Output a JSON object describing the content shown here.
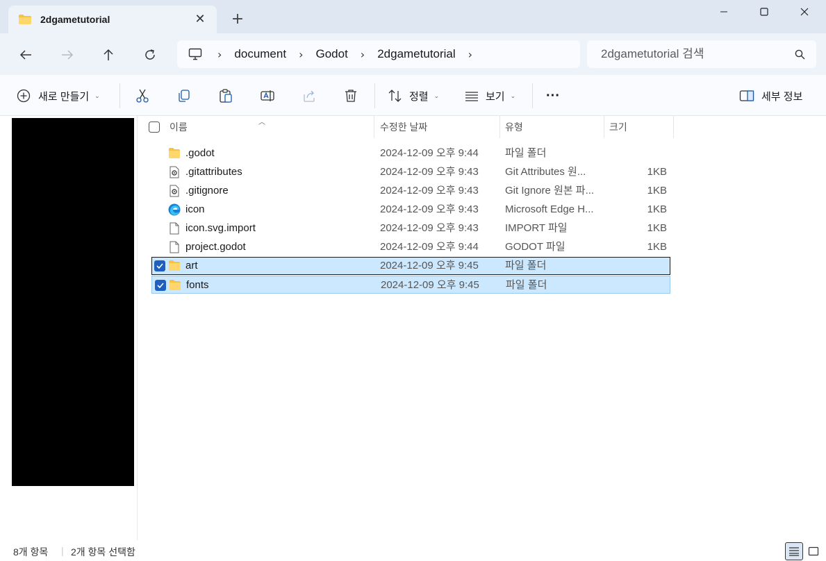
{
  "window": {
    "tab_title": "2dgametutorial",
    "minimize": "minimize",
    "maximize": "maximize",
    "close": "close"
  },
  "address": {
    "crumbs": [
      "document",
      "Godot",
      "2dgametutorial"
    ],
    "search_placeholder": "2dgametutorial 검색"
  },
  "toolbar": {
    "new_label": "새로 만들기",
    "sort_label": "정렬",
    "view_label": "보기",
    "more_label": "···",
    "details_label": "세부 정보"
  },
  "columns": {
    "name": "이름",
    "date": "수정한 날짜",
    "type": "유형",
    "size": "크기"
  },
  "files": [
    {
      "name": ".godot",
      "date": "2024-12-09 오후 9:44",
      "type": "파일 폴더",
      "size": "",
      "icon": "folder-icon",
      "selected": false
    },
    {
      "name": ".gitattributes",
      "date": "2024-12-09 오후 9:43",
      "type": "Git Attributes 원...",
      "size": "1KB",
      "icon": "settings-file-icon",
      "selected": false
    },
    {
      "name": ".gitignore",
      "date": "2024-12-09 오후 9:43",
      "type": "Git Ignore 원본 파...",
      "size": "1KB",
      "icon": "settings-file-icon",
      "selected": false
    },
    {
      "name": "icon",
      "date": "2024-12-09 오후 9:43",
      "type": "Microsoft Edge H...",
      "size": "1KB",
      "icon": "edge-icon",
      "selected": false
    },
    {
      "name": "icon.svg.import",
      "date": "2024-12-09 오후 9:43",
      "type": "IMPORT 파일",
      "size": "1KB",
      "icon": "file-icon",
      "selected": false
    },
    {
      "name": "project.godot",
      "date": "2024-12-09 오후 9:44",
      "type": "GODOT 파일",
      "size": "1KB",
      "icon": "file-icon",
      "selected": false
    },
    {
      "name": "art",
      "date": "2024-12-09 오후 9:45",
      "type": "파일 폴더",
      "size": "",
      "icon": "folder-icon",
      "selected": true
    },
    {
      "name": "fonts",
      "date": "2024-12-09 오후 9:45",
      "type": "파일 폴더",
      "size": "",
      "icon": "folder-icon",
      "selected": true
    }
  ],
  "status": {
    "item_count": "8개 항목",
    "selected_count": "2개 항목 선택함"
  },
  "colors": {
    "accent": "#1f5fbf",
    "selection": "#cce8ff",
    "folder": "#f5c242"
  }
}
